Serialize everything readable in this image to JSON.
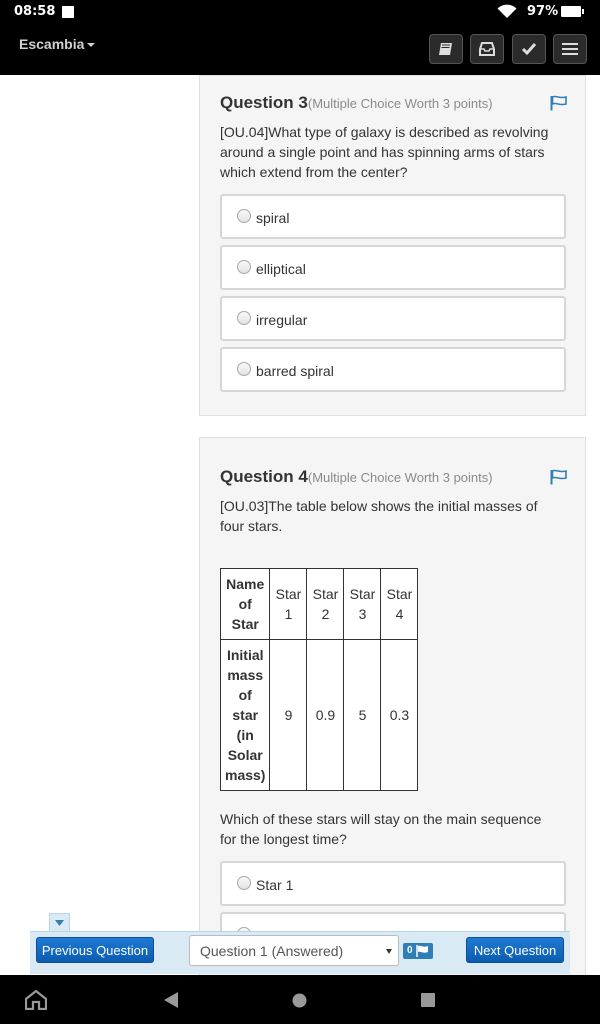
{
  "status_bar": {
    "time": "08:58",
    "battery": "97%"
  },
  "header": {
    "school": "Escambia"
  },
  "toolbar": {
    "icons": [
      "book-icon",
      "inbox-icon",
      "check-icon",
      "menu-icon"
    ]
  },
  "questions": [
    {
      "title": "Question 3",
      "worth": "(Multiple Choice Worth 3 points)",
      "text": "[OU.04]What type of galaxy is described as revolving around a single point and has spinning arms of stars which extend from the center?",
      "choices": [
        "spiral",
        "elliptical",
        "irregular",
        "barred spiral"
      ]
    },
    {
      "title": "Question 4",
      "worth": "(Multiple Choice Worth 3 points)",
      "text": "[OU.03]The table below shows the initial masses of four stars.",
      "table": {
        "row_headers": [
          "Name of Star",
          "Initial mass of star (in Solar mass)"
        ],
        "columns": [
          "Star 1",
          "Star 2",
          "Star 3",
          "Star 4"
        ],
        "values": [
          "9",
          "0.9",
          "5",
          "0.3"
        ]
      },
      "prompt": "Which of these stars will stay on the main sequence for the longest time?",
      "choices": [
        "Star 1"
      ]
    }
  ],
  "bottom_nav": {
    "prev_label": "Previous Question",
    "select_value": "Question 1 (Answered)",
    "flag_count": "0",
    "next_label": "Next Question"
  },
  "colors": {
    "accent": "#0b5cb0",
    "flag": "#2f7fb6",
    "nav_bg": "#d9eaf5"
  }
}
